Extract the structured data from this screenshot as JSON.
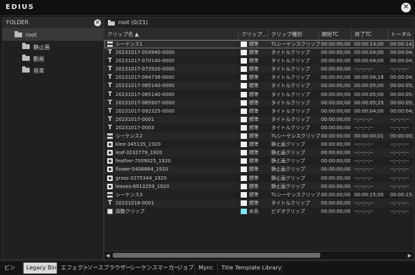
{
  "app": {
    "title": "EDIUS"
  },
  "folder": {
    "header": "FOLDER",
    "items": [
      {
        "label": "root",
        "selected": true,
        "depth": 0
      },
      {
        "label": "静止画",
        "selected": false,
        "depth": 1
      },
      {
        "label": "動画",
        "selected": false,
        "depth": 1
      },
      {
        "label": "音楽",
        "selected": false,
        "depth": 1
      }
    ]
  },
  "bin": {
    "path": "root (0/21)",
    "columns": [
      "クリップ名 ▲",
      "クリップ...",
      "クリップ種別",
      "開始TC",
      "終了TC",
      "トータル"
    ],
    "rows": [
      {
        "icon": "sequence",
        "name": "シーケンス1",
        "color": "white",
        "colorLabel": "標準",
        "type": "TLシーケンスクリップ",
        "start": "00:00:00;00",
        "end": "00:00:14;00",
        "total": "00:00:14;00"
      },
      {
        "icon": "title",
        "name": "20231017-054940-0000",
        "color": "white",
        "colorLabel": "標準",
        "type": "タイトルクリップ",
        "start": "00:00:00;00",
        "end": "00:00:04;00",
        "total": "00:00:04;0"
      },
      {
        "icon": "title",
        "name": "20231017-070140-0000",
        "color": "white",
        "colorLabel": "標準",
        "type": "タイトルクリップ",
        "start": "00:00:00;00",
        "end": "00:00:04;00",
        "total": "00:00:04;0"
      },
      {
        "icon": "title",
        "name": "20231017-073920-0000",
        "color": "white",
        "colorLabel": "標準",
        "type": "タイトルクリップ",
        "start": "00:00:00;00",
        "end": "--;--;--;--",
        "total": "--;--;--;--"
      },
      {
        "icon": "title",
        "name": "20231017-084738-0000",
        "color": "white",
        "colorLabel": "標準",
        "type": "タイトルクリップ",
        "start": "00:00:00;00",
        "end": "00:00:04;18",
        "total": "00:00:04;1"
      },
      {
        "icon": "title",
        "name": "20231017-085140-0000",
        "color": "white",
        "colorLabel": "標準",
        "type": "タイトルクリップ",
        "start": "00:00:00;00",
        "end": "00:00:05;00",
        "total": "00:00:05;0"
      },
      {
        "icon": "title",
        "name": "20231017-085140-0000",
        "color": "white",
        "colorLabel": "標準",
        "type": "タイトルクリップ",
        "start": "00:00:00;00",
        "end": "00:00:05;00",
        "total": "00:00:05;0"
      },
      {
        "icon": "title",
        "name": "20231017-085907-0000",
        "color": "white",
        "colorLabel": "標準",
        "type": "タイトルクリップ",
        "start": "00:00:00;00",
        "end": "00:00:05;25",
        "total": "00:00:05;2"
      },
      {
        "icon": "title",
        "name": "20231017-092325-0000",
        "color": "white",
        "colorLabel": "標準",
        "type": "タイトルクリップ",
        "start": "00:00:00;00",
        "end": "00:00:04;00",
        "total": "00:00:04;0"
      },
      {
        "icon": "title",
        "name": "20231017-0001",
        "color": "white",
        "colorLabel": "標準",
        "type": "タイトルクリップ",
        "start": "00:00:00;00",
        "end": "--;--;--;--",
        "total": "--;--;--;--"
      },
      {
        "icon": "title",
        "name": "20231017-0003",
        "color": "white",
        "colorLabel": "標準",
        "type": "タイトルクリップ",
        "start": "00:00:00;00",
        "end": "--;--;--;--",
        "total": "--;--;--;--"
      },
      {
        "icon": "sequence",
        "name": "シーケンス2",
        "color": "white",
        "colorLabel": "標準",
        "type": "TLシーケンスクリップ",
        "start": "00:00:00;00",
        "end": "00:00:00;01",
        "total": "00:00:00;0"
      },
      {
        "icon": "image",
        "name": "klee-345135_1920",
        "color": "white",
        "colorLabel": "標準",
        "type": "静止画クリップ",
        "start": "00:00:00;00",
        "end": "--;--;--;--",
        "total": "--;--;--;--"
      },
      {
        "icon": "image",
        "name": "leaf-3232779_1920",
        "color": "white",
        "colorLabel": "標準",
        "type": "静止画クリップ",
        "start": "00:00:00;00",
        "end": "--;--;--;--",
        "total": "--;--;--;--"
      },
      {
        "icon": "image",
        "name": "feather-7009025_1920",
        "color": "white",
        "colorLabel": "標準",
        "type": "静止画クリップ",
        "start": "00:00:00;00",
        "end": "--;--;--;--",
        "total": "--;--;--;--"
      },
      {
        "icon": "image",
        "name": "flower-5406664_1920",
        "color": "white",
        "colorLabel": "標準",
        "type": "静止画クリップ",
        "start": "00:00:00;00",
        "end": "--;--;--;--",
        "total": "--;--;--;--"
      },
      {
        "icon": "image",
        "name": "grass-3375344_1920",
        "color": "white",
        "colorLabel": "標準",
        "type": "静止画クリップ",
        "start": "00:00:00;00",
        "end": "--;--;--;--",
        "total": "--;--;--;--"
      },
      {
        "icon": "image",
        "name": "leaves-6913259_1920",
        "color": "white",
        "colorLabel": "標準",
        "type": "静止画クリップ",
        "start": "00:00:00;00",
        "end": "--;--;--;--",
        "total": "--;--;--;--"
      },
      {
        "icon": "sequence",
        "name": "シーケンス3",
        "color": "white",
        "colorLabel": "標準",
        "type": "TLシーケンスクリップ",
        "start": "00:00:00;00",
        "end": "00:00:15;00",
        "total": "00:00:15;0"
      },
      {
        "icon": "title",
        "name": "20231018-0001",
        "color": "white",
        "colorLabel": "標準",
        "type": "タイトルクリップ",
        "start": "00:00:00;00",
        "end": "--;--;--;--",
        "total": "--;--;--;--"
      },
      {
        "icon": "adjust",
        "name": "調整クリップ",
        "color": "cyan",
        "colorLabel": "水色",
        "type": "ビデオクリップ",
        "start": "00:00:00;00",
        "end": "--;--;--;--",
        "total": "--;--;--;--"
      }
    ]
  },
  "tabs": [
    {
      "label": "ビン",
      "active": false
    },
    {
      "label": "Legacy Bin",
      "active": true
    },
    {
      "label": "エフェクト",
      "active": false
    },
    {
      "label": "ソースブラウザー",
      "active": false
    },
    {
      "label": "シーケンスマーカー",
      "active": false
    },
    {
      "label": "ジョブ",
      "active": false
    },
    {
      "label": "Mync",
      "active": false
    },
    {
      "label": "Title Template Library",
      "active": false
    }
  ],
  "icons": {
    "close": "close-icon",
    "folder": "folder-icon"
  }
}
